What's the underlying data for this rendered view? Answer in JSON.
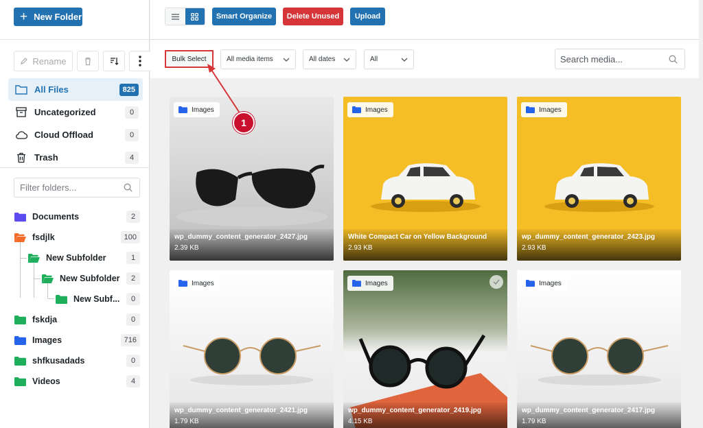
{
  "sidebar": {
    "new_folder_label": "New Folder",
    "rename_label": "Rename",
    "nav": [
      {
        "label": "All Files",
        "count": "825",
        "icon": "folder-outline-icon"
      },
      {
        "label": "Uncategorized",
        "count": "0",
        "icon": "archive-icon"
      },
      {
        "label": "Cloud Offload",
        "count": "0",
        "icon": "cloud-icon"
      },
      {
        "label": "Trash",
        "count": "4",
        "icon": "trash-icon"
      }
    ],
    "filter_placeholder": "Filter folders...",
    "folders": [
      {
        "label": "Documents",
        "count": "2",
        "color": "#5b4cf0"
      },
      {
        "label": "fsdjlk",
        "count": "100",
        "color": "#f26b2b"
      },
      {
        "label": "New Subfolder",
        "count": "1",
        "color": "#1fae5b"
      },
      {
        "label": "New Subfolder",
        "count": "2",
        "color": "#1fae5b"
      },
      {
        "label": "New Subf...",
        "count": "0",
        "color": "#1fae5b"
      },
      {
        "label": "fskdja",
        "count": "0",
        "color": "#1fae5b"
      },
      {
        "label": "Images",
        "count": "716",
        "color": "#2563eb"
      },
      {
        "label": "shfkusadads",
        "count": "0",
        "color": "#1fae5b"
      },
      {
        "label": "Videos",
        "count": "4",
        "color": "#1fae5b"
      }
    ]
  },
  "toolbar": {
    "smart_organize": "Smart Organize",
    "delete_unused": "Delete Unused",
    "upload": "Upload",
    "accent": "#2271b1",
    "danger": "#d63638"
  },
  "filters": {
    "bulk_select": "Bulk Select",
    "media_type": "All media items",
    "dates": "All dates",
    "other": "All",
    "search_placeholder": "Search media..."
  },
  "annotation": {
    "number": "1"
  },
  "media": [
    {
      "folder": "Images",
      "name": "wp_dummy_content_generator_2427.jpg",
      "size": "2.39 KB"
    },
    {
      "folder": "Images",
      "name": "White Compact Car on Yellow Background",
      "size": "2.93 KB"
    },
    {
      "folder": "Images",
      "name": "wp_dummy_content_generator_2423.jpg",
      "size": "2.93 KB"
    },
    {
      "folder": "Images",
      "name": "wp_dummy_content_generator_2421.jpg",
      "size": "1.79 KB"
    },
    {
      "folder": "Images",
      "name": "wp_dummy_content_generator_2419.jpg",
      "size": "4.15 KB"
    },
    {
      "folder": "Images",
      "name": "wp_dummy_content_generator_2417.jpg",
      "size": "1.79 KB"
    }
  ]
}
